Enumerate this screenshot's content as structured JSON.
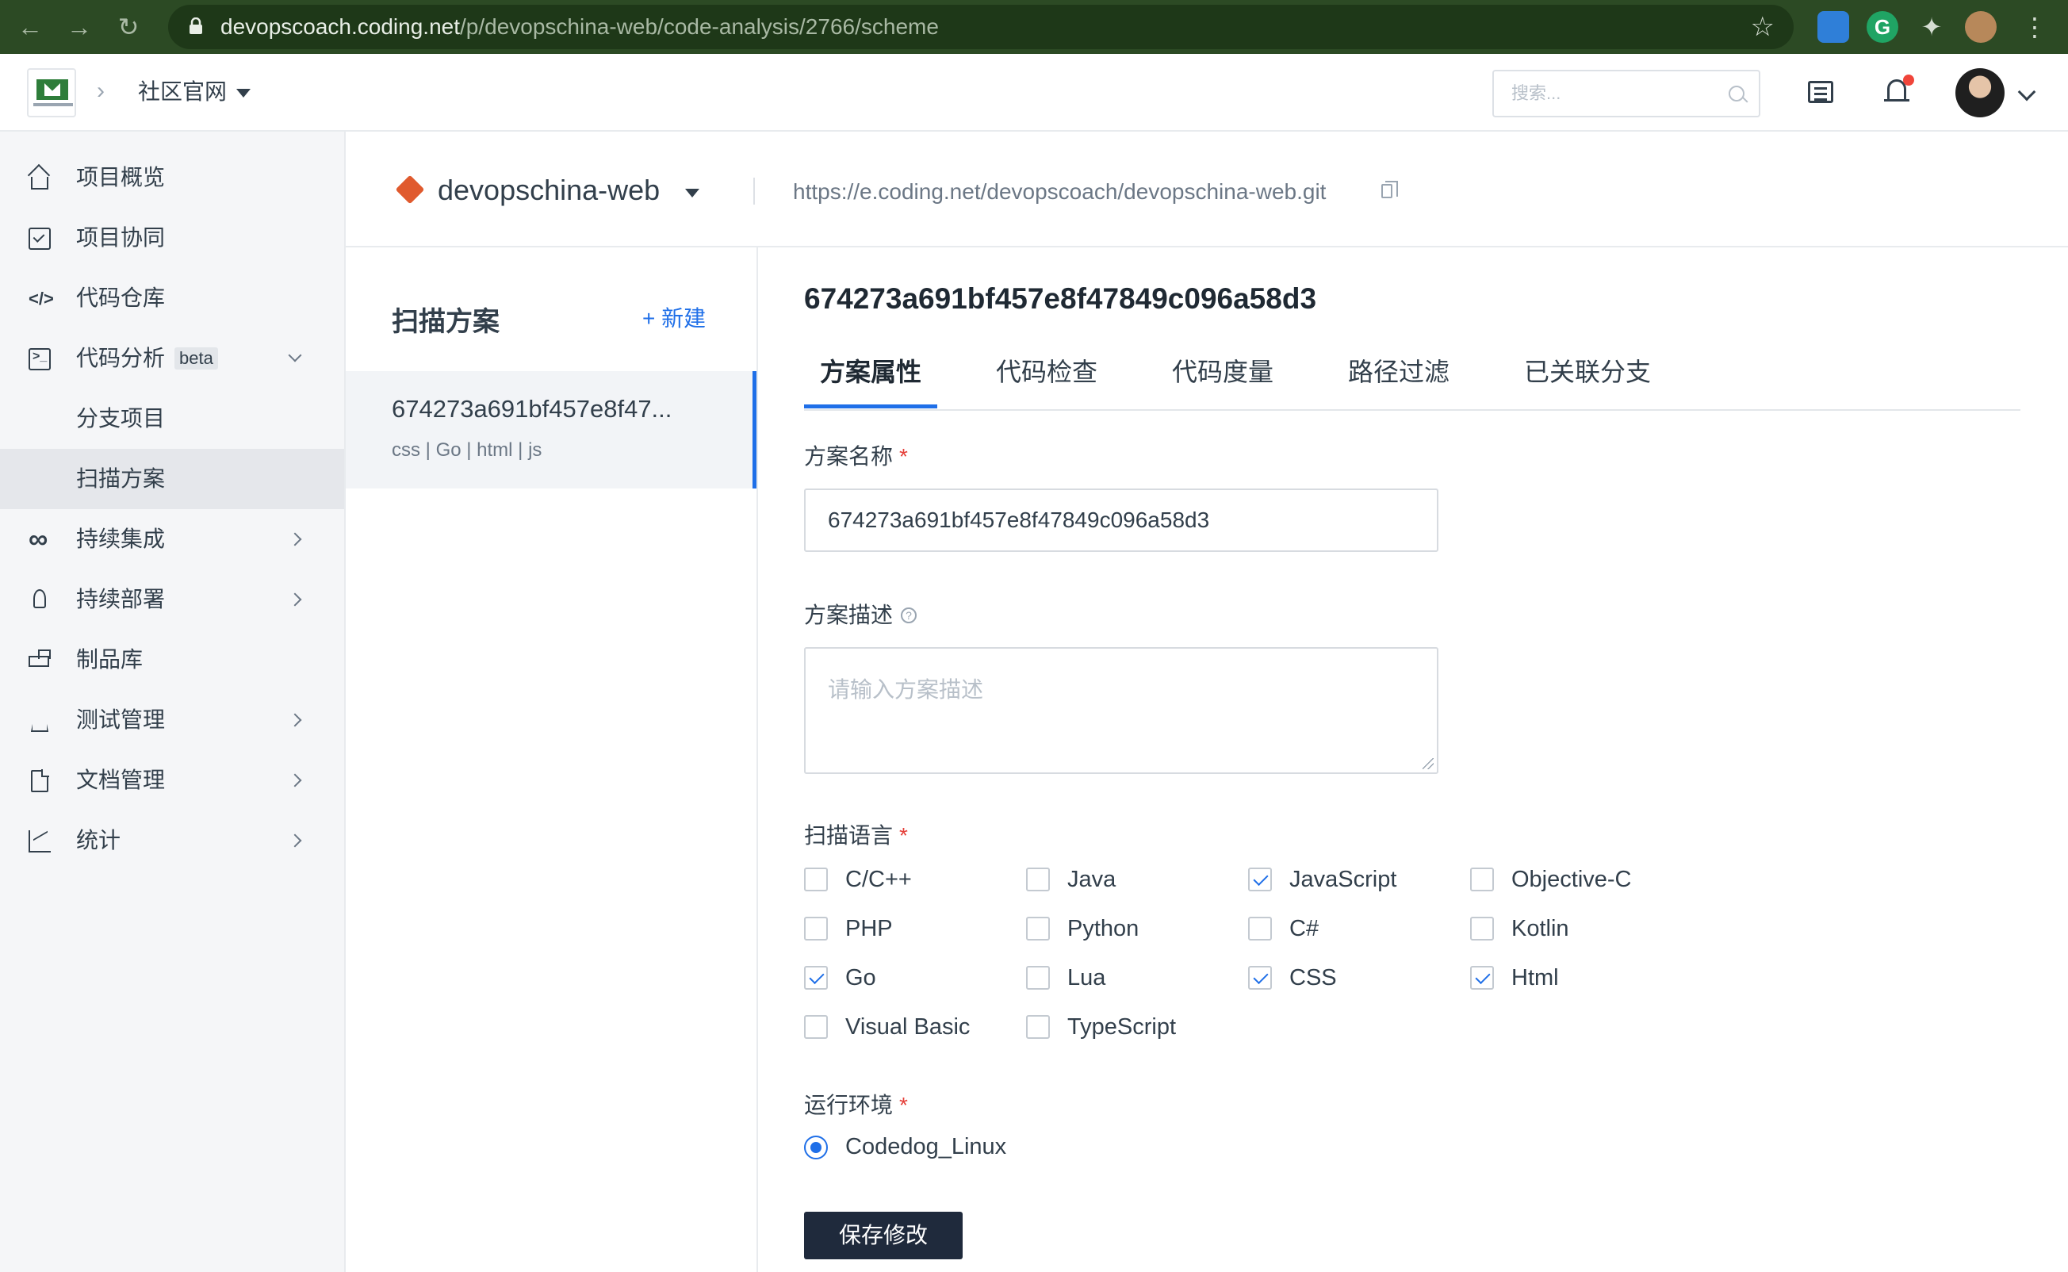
{
  "browser": {
    "url_host": "devopscoach.coding.net",
    "url_path": "/p/devopschina-web/code-analysis/2766/scheme"
  },
  "header": {
    "team_name": "社区官网",
    "search_placeholder": "搜索..."
  },
  "sidebar": {
    "items": [
      {
        "label": "项目概览",
        "icon": "home-icon"
      },
      {
        "label": "项目协同",
        "icon": "checkbox-icon"
      },
      {
        "label": "代码仓库",
        "icon": "code-icon"
      },
      {
        "label": "代码分析",
        "icon": "terminal-icon",
        "badge": "beta",
        "expanded": true
      },
      {
        "label": "分支项目",
        "sub": true
      },
      {
        "label": "扫描方案",
        "sub": true,
        "active": true
      },
      {
        "label": "持续集成",
        "icon": "infinity-icon"
      },
      {
        "label": "持续部署",
        "icon": "rocket-icon"
      },
      {
        "label": "制品库",
        "icon": "box-icon"
      },
      {
        "label": "测试管理",
        "icon": "flask-icon"
      },
      {
        "label": "文档管理",
        "icon": "document-icon"
      },
      {
        "label": "统计",
        "icon": "chart-icon"
      }
    ]
  },
  "repo": {
    "name": "devopschina-web",
    "url": "https://e.coding.net/devopscoach/devopschina-web.git"
  },
  "schemes": {
    "title": "扫描方案",
    "new_label": "+ 新建",
    "items": [
      {
        "name": "674273a691bf457e8f47...",
        "langs": "css | Go | html | js"
      }
    ]
  },
  "detail": {
    "title": "674273a691bf457e8f47849c096a58d3",
    "tabs": [
      "方案属性",
      "代码检查",
      "代码度量",
      "路径过滤",
      "已关联分支"
    ],
    "active_tab": 0,
    "name_label": "方案名称",
    "name_value": "674273a691bf457e8f47849c096a58d3",
    "desc_label": "方案描述",
    "desc_placeholder": "请输入方案描述",
    "lang_label": "扫描语言",
    "languages": [
      {
        "name": "C/C++",
        "checked": false
      },
      {
        "name": "Java",
        "checked": false
      },
      {
        "name": "JavaScript",
        "checked": true
      },
      {
        "name": "Objective-C",
        "checked": false
      },
      {
        "name": "PHP",
        "checked": false
      },
      {
        "name": "Python",
        "checked": false
      },
      {
        "name": "C#",
        "checked": false
      },
      {
        "name": "Kotlin",
        "checked": false
      },
      {
        "name": "Go",
        "checked": true
      },
      {
        "name": "Lua",
        "checked": false
      },
      {
        "name": "CSS",
        "checked": true
      },
      {
        "name": "Html",
        "checked": true
      },
      {
        "name": "Visual Basic",
        "checked": false
      },
      {
        "name": "TypeScript",
        "checked": false
      }
    ],
    "env_label": "运行环境",
    "env_value": "Codedog_Linux",
    "save_label": "保存修改"
  },
  "colors": {
    "accent": "#1F6FE8",
    "required": "#E5403A",
    "chrome": "#2C4A24",
    "primary_button": "#1F2A3C"
  }
}
